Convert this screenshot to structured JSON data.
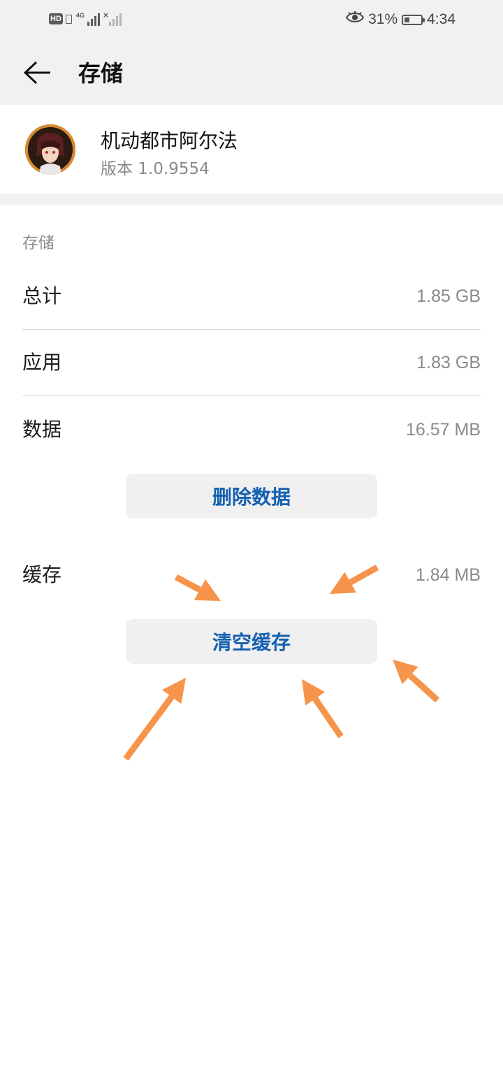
{
  "status_bar": {
    "hd_badge": "HD",
    "network_type": "4G",
    "battery_percent": "31%",
    "battery_level": 0.31,
    "time": "4:34"
  },
  "app_bar": {
    "title": "存储"
  },
  "app_info": {
    "name": "机动都市阿尔法",
    "version": "版本 1.0.9554"
  },
  "storage": {
    "section_title": "存储",
    "rows": [
      {
        "label": "总计",
        "value": "1.85 GB"
      },
      {
        "label": "应用",
        "value": "1.83 GB"
      },
      {
        "label": "数据",
        "value": "16.57 MB"
      }
    ],
    "delete_data_label": "删除数据",
    "cache": {
      "label": "缓存",
      "value": "1.84 MB"
    },
    "clear_cache_label": "清空缓存"
  },
  "colors": {
    "accent_blue": "#1560b0",
    "annotation_arrow": "#f5944a",
    "header_bg": "#f1f1f1"
  }
}
